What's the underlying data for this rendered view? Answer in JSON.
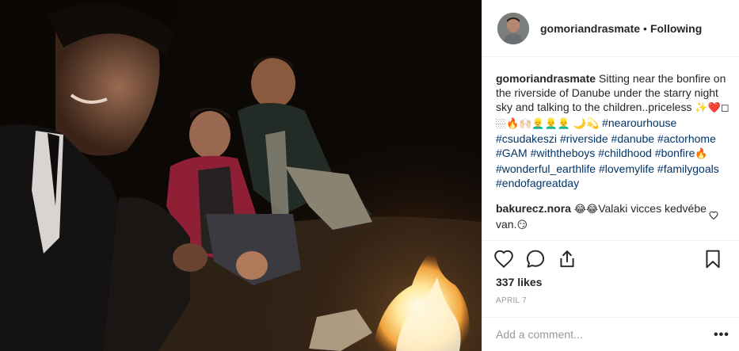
{
  "post": {
    "username": "gomoriandrasmate",
    "separator": "•",
    "follow_status": "Following",
    "caption": {
      "username": "gomoriandrasmate",
      "text": "Sitting near the bonfire on the riverside of Danube under the starry night sky and talking to the children..priceless ",
      "emojis_1": "✨❤️◻🏼🔥🙌🏻👱‍♂️👱‍♂️👱‍♂️",
      "emojis_2": "🌙💫",
      "hashtags": [
        "#nearourhouse",
        "#csudakeszi",
        "#riverside",
        "#danube",
        "#actorhome",
        "#GAM",
        "#withtheboys",
        "#childhood",
        "#bonfire",
        "#wonderful_earthlife",
        "#lovemylife",
        "#familygoals",
        "#endofagreatday"
      ],
      "trailing_emoji": "🔥"
    },
    "comment": {
      "username": "bakurecz.nora",
      "emojis": "😂😂",
      "text": "Valaki vicces kedvébe van.",
      "trailing_emoji": "😏"
    },
    "likes": "337 likes",
    "date": "APRIL 7",
    "add_comment_placeholder": "Add a comment...",
    "more_label": "•••"
  },
  "icons": {
    "like": "heart-icon",
    "comment": "comment-bubble-icon",
    "share": "share-icon",
    "save": "bookmark-icon",
    "comment_like": "small-heart-icon"
  },
  "colors": {
    "text": "#262626",
    "hashtag": "#003569",
    "muted": "#999999",
    "border": "#efefef"
  }
}
